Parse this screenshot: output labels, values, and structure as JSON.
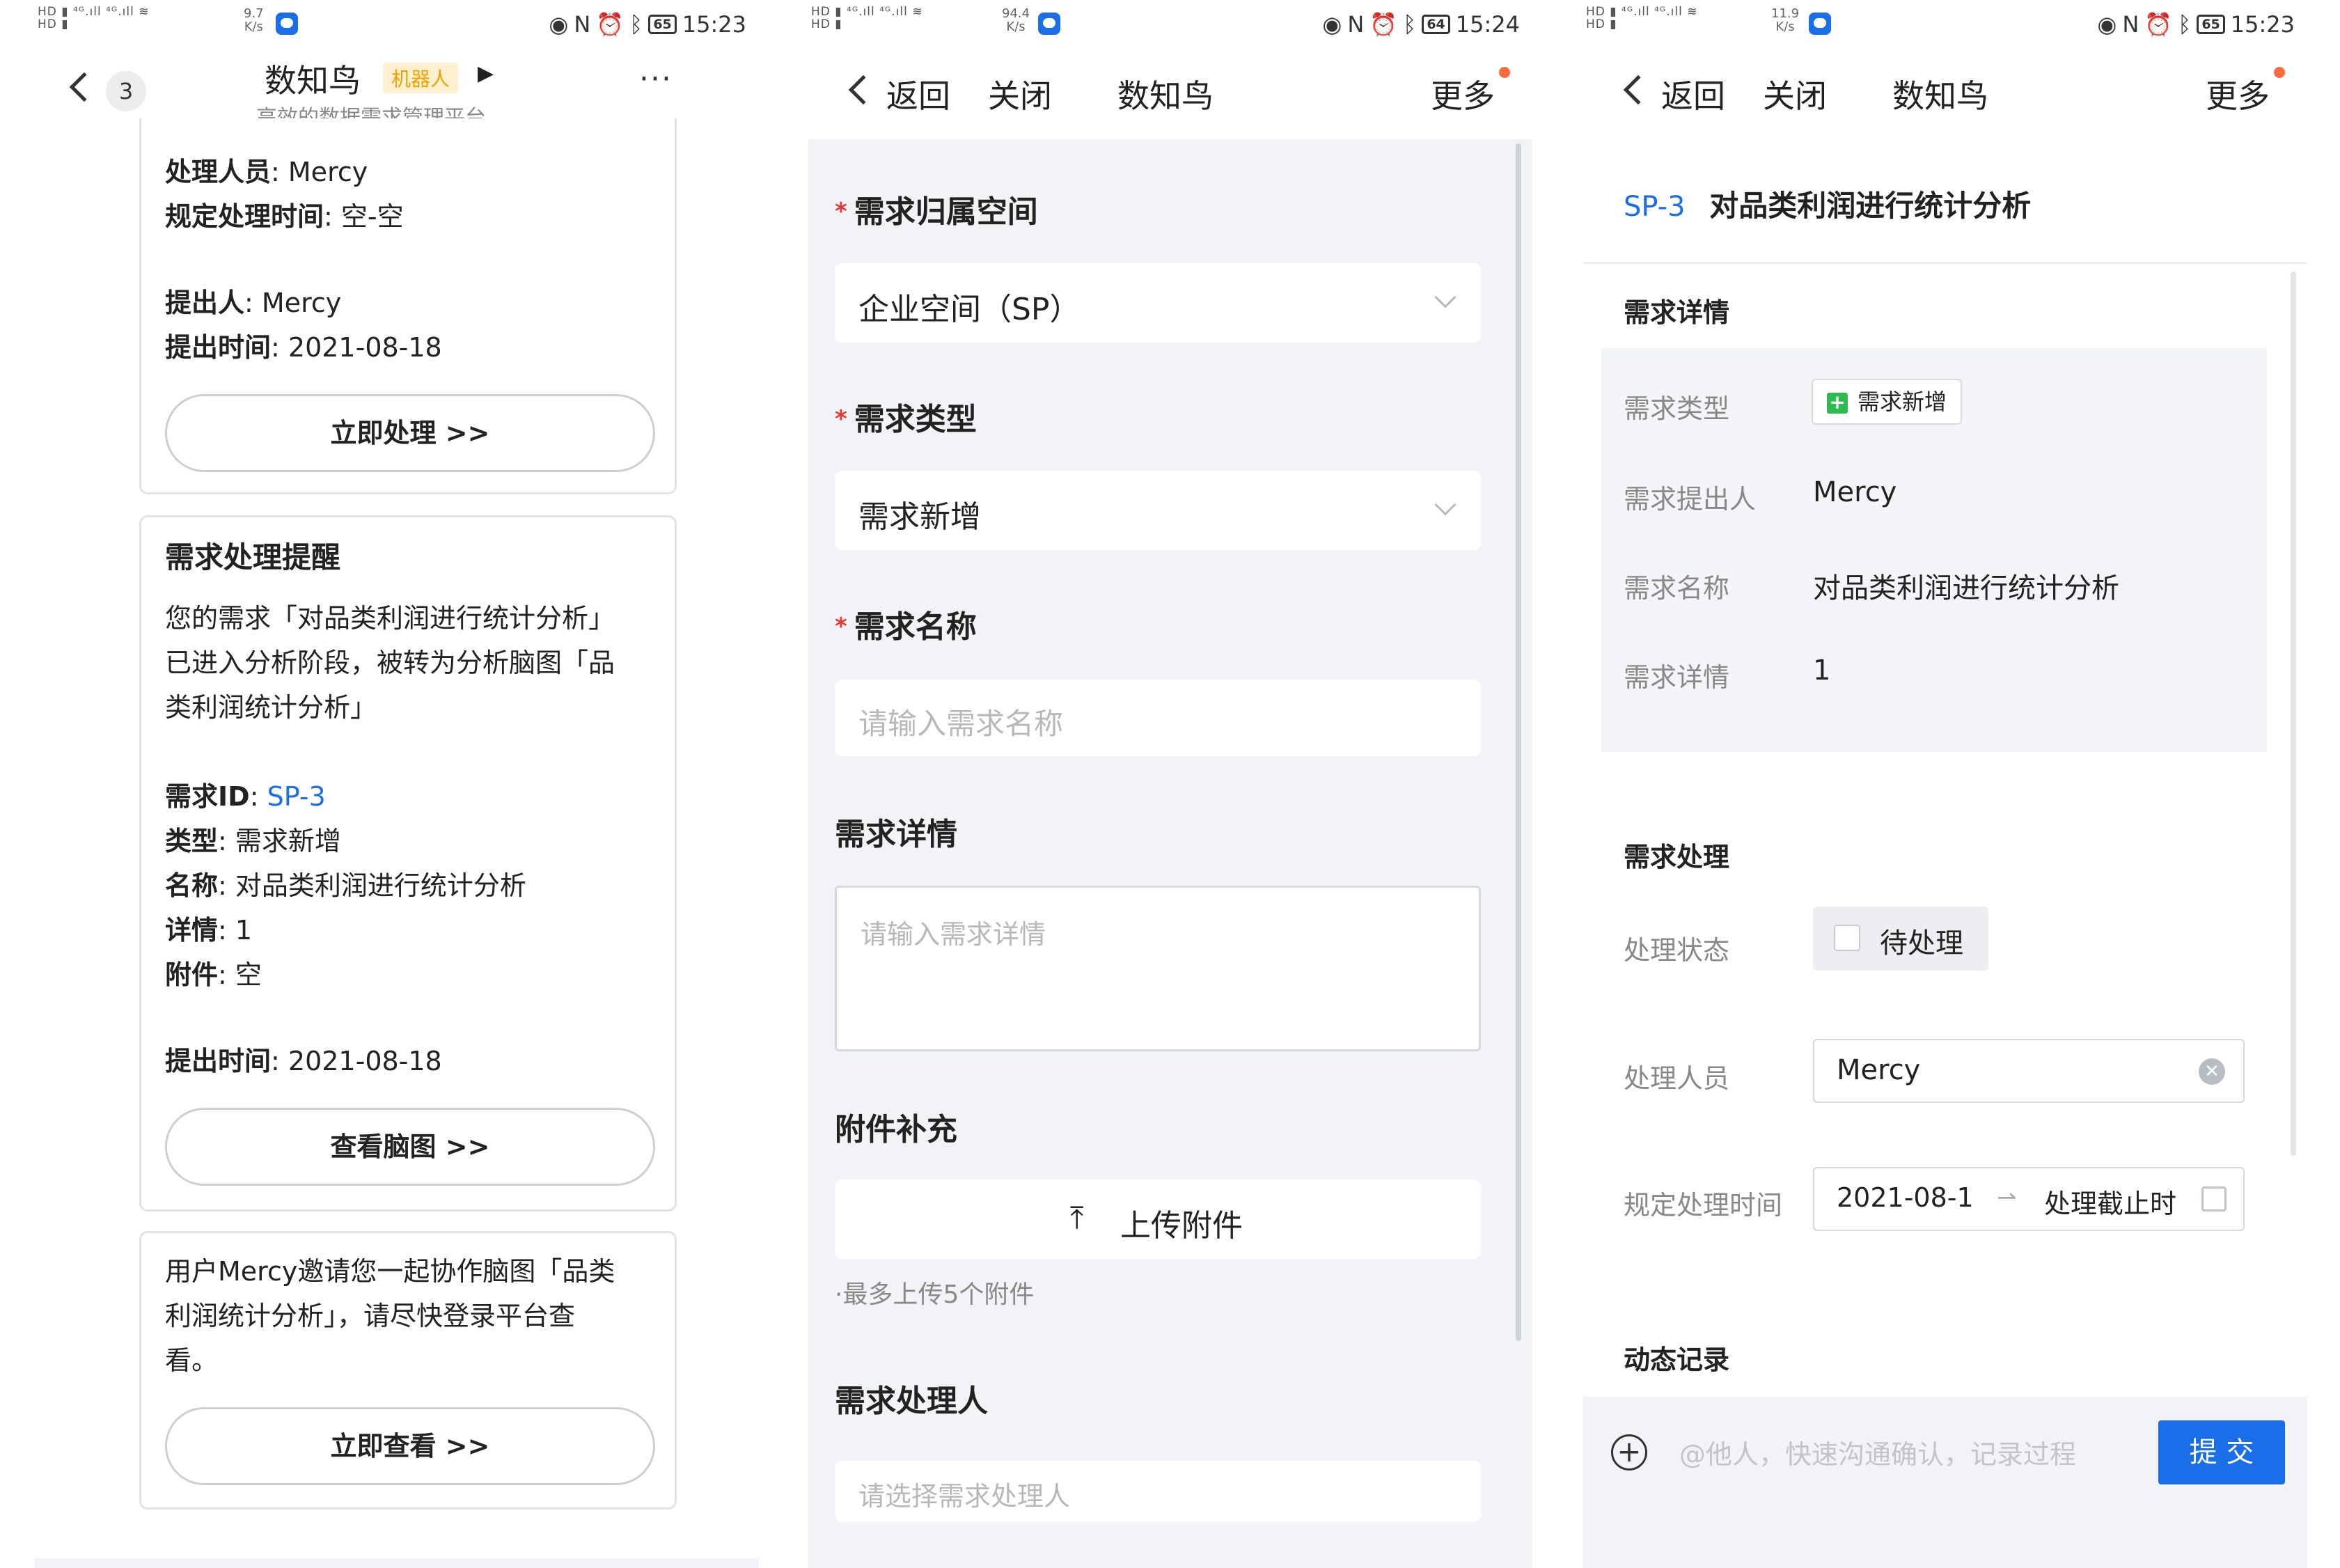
{
  "status_bars": [
    {
      "speed": "9.7",
      "speed_unit": "K/s",
      "battery": "65",
      "time": "15:23"
    },
    {
      "speed": "94.4",
      "speed_unit": "K/s",
      "battery": "64",
      "time": "15:24"
    },
    {
      "speed": "11.9",
      "speed_unit": "K/s",
      "battery": "65",
      "time": "15:23"
    }
  ],
  "chat": {
    "back_badge": "3",
    "title": "数知鸟",
    "robot_tag": "机器人",
    "subtitle": "高效的数据需求管理平台",
    "more": "···",
    "card1": {
      "handler_key": "处理人员",
      "handler_val": ": Mercy",
      "time_key": "规定处理时间",
      "time_val": ": 空-空",
      "proposer_key": "提出人",
      "proposer_val": ": Mercy",
      "proposed_key": "提出时间",
      "proposed_val": ":  2021-08-18",
      "button": "立即处理 >>"
    },
    "card2": {
      "title": "需求处理提醒",
      "body_lines": [
        "您的需求「对品类利润进行统计分析」",
        "已进入分析阶段，被转为分析脑图「品",
        "类利润统计分析」"
      ],
      "id_key": "需求ID",
      "id_sep": ": ",
      "id_val": "SP-3",
      "type_key": "类型",
      "type_val": ": 需求新增",
      "name_key": "名称",
      "name_val": ": 对品类利润进行统计分析",
      "detail_key": "详情",
      "detail_val": ": 1",
      "attach_key": "附件",
      "attach_val": ": 空",
      "proposed_key": "提出时间",
      "proposed_val": ":  2021-08-18",
      "button": "查看脑图 >>"
    },
    "card3": {
      "body_lines": [
        "用户Mercy邀请您一起协作脑图「品类",
        "利润统计分析」，请尽快登录平台查",
        "看。"
      ],
      "button": "立即查看 >>"
    }
  },
  "form": {
    "nav": {
      "back": "返回",
      "close": "关闭",
      "title": "数知鸟",
      "more": "更多"
    },
    "space_label": "需求归属空间",
    "space_value": "企业空间（SP）",
    "type_label": "需求类型",
    "type_value": "需求新增",
    "name_label": "需求名称",
    "name_placeholder": "请输入需求名称",
    "detail_label": "需求详情",
    "detail_placeholder": "请输入需求详情",
    "attach_label": "附件补充",
    "upload_label": "上传附件",
    "upload_hint": "·最多上传5个附件",
    "handler_label": "需求处理人",
    "handler_placeholder": "请选择需求处理人"
  },
  "detail": {
    "nav": {
      "back": "返回",
      "close": "关闭",
      "title": "数知鸟",
      "more": "更多"
    },
    "req_id": "SP-3",
    "req_title": "对品类利润进行统计分析",
    "section_detail": "需求详情",
    "rows": [
      {
        "key": "需求类型",
        "val": "需求新增"
      },
      {
        "key": "需求提出人",
        "val": "Mercy"
      },
      {
        "key": "需求名称",
        "val": "对品类利润进行统计分析"
      },
      {
        "key": "需求详情",
        "val": "1"
      }
    ],
    "section_process": "需求处理",
    "status_key": "处理状态",
    "status_val": "待处理",
    "handler_key": "处理人员",
    "handler_val": "Mercy",
    "time_key": "规定处理时间",
    "time_start": "2021-08-1",
    "time_end": "处理截止时",
    "section_log": "动态记录",
    "comment_placeholder": "@他人，快速沟通确认，记录过程",
    "submit": "提 交"
  },
  "colors": {
    "accent": "#1a6fe8",
    "required": "#e53935",
    "notify_dot": "#ff6a3d",
    "tag_bg": "#fff1cf",
    "tag_text": "#f0a000"
  }
}
